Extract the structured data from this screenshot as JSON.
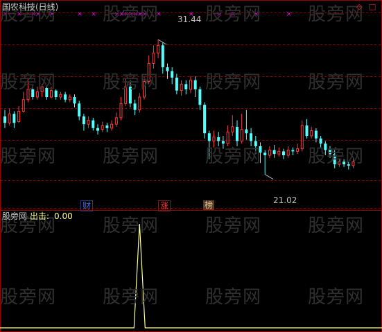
{
  "main_title": "国农科技(日线)",
  "indicator": {
    "source": "股旁网",
    "name": "出击:",
    "value": "0.00"
  },
  "annotations": {
    "high_price": "31.44",
    "low_price": "21.02"
  },
  "event_tags": [
    {
      "text": "财",
      "color": "#4d6bd6"
    },
    {
      "text": "涨",
      "color": "#e04040"
    },
    {
      "text": "榜",
      "color": "#d8c8a0"
    }
  ],
  "watermark": "股旁网",
  "colors": {
    "up": "#ff3b3b",
    "down": "#54ffff",
    "grid": "#800000",
    "signal_x": "#ff00ff",
    "indicator_line": "#ffff99",
    "price_text": "#c0c0c0",
    "title": "#c0c0c0"
  },
  "chart_data": {
    "type": "candlestick",
    "y_range": [
      19.5,
      33
    ],
    "high_marker": 31.44,
    "low_marker": 21.02,
    "candles": [
      [
        25.5,
        25.0,
        26.0,
        24.6
      ],
      [
        25.0,
        25.7,
        26.1,
        24.8
      ],
      [
        25.7,
        25.0,
        25.9,
        24.6
      ],
      [
        25.1,
        25.9,
        26.3,
        25.0
      ],
      [
        25.9,
        26.8,
        27.4,
        25.8
      ],
      [
        26.8,
        27.6,
        28.4,
        26.6
      ],
      [
        27.6,
        27.0,
        27.9,
        26.8
      ],
      [
        27.0,
        27.4,
        27.8,
        26.8
      ],
      [
        27.4,
        27.8,
        28.0,
        27.0
      ],
      [
        27.7,
        27.0,
        27.9,
        26.8
      ],
      [
        27.0,
        27.5,
        27.8,
        26.9
      ],
      [
        27.5,
        27.0,
        27.6,
        26.8
      ],
      [
        27.0,
        27.2,
        27.4,
        26.8
      ],
      [
        27.2,
        26.8,
        27.4,
        26.6
      ],
      [
        26.8,
        27.0,
        27.2,
        26.6
      ],
      [
        27.0,
        26.5,
        27.2,
        26.2
      ],
      [
        26.5,
        25.5,
        26.7,
        25.2
      ],
      [
        25.5,
        24.9,
        25.7,
        24.4
      ],
      [
        24.9,
        25.2,
        25.5,
        24.6
      ],
      [
        25.2,
        24.6,
        25.4,
        24.4
      ],
      [
        24.6,
        24.4,
        24.9,
        24.1
      ],
      [
        24.5,
        24.8,
        25.1,
        24.3
      ],
      [
        24.8,
        24.6,
        25.0,
        24.3
      ],
      [
        24.6,
        24.9,
        25.2,
        24.4
      ],
      [
        24.9,
        25.4,
        25.8,
        24.7
      ],
      [
        25.4,
        26.5,
        27.0,
        25.2
      ],
      [
        26.5,
        27.8,
        28.4,
        26.3
      ],
      [
        27.8,
        26.5,
        28.2,
        26.2
      ],
      [
        26.5,
        26.0,
        26.8,
        25.6
      ],
      [
        26.0,
        27.0,
        27.3,
        25.8
      ],
      [
        27.0,
        28.2,
        28.6,
        26.8
      ],
      [
        28.2,
        29.6,
        30.2,
        28.0
      ],
      [
        29.6,
        30.4,
        31.0,
        29.2
      ],
      [
        30.4,
        31.0,
        31.44,
        30.0
      ],
      [
        31.0,
        29.3,
        31.2,
        28.8
      ],
      [
        29.3,
        29.0,
        29.6,
        28.4
      ],
      [
        29.0,
        28.5,
        29.3,
        28.0
      ],
      [
        28.5,
        27.5,
        28.8,
        27.2
      ],
      [
        27.5,
        28.0,
        28.3,
        27.1
      ],
      [
        28.0,
        27.6,
        28.3,
        27.2
      ],
      [
        27.6,
        28.3,
        28.6,
        27.3
      ],
      [
        28.3,
        27.6,
        28.6,
        27.0
      ],
      [
        27.6,
        26.4,
        27.8,
        26.0
      ],
      [
        26.4,
        24.2,
        26.6,
        23.8
      ],
      [
        24.2,
        23.6,
        24.4,
        22.2
      ],
      [
        23.6,
        23.9,
        24.4,
        23.1
      ],
      [
        23.9,
        23.6,
        24.3,
        23.2
      ],
      [
        23.6,
        23.4,
        24.0,
        23.0
      ],
      [
        23.4,
        24.3,
        24.8,
        23.2
      ],
      [
        24.3,
        24.7,
        25.6,
        24.0
      ],
      [
        24.7,
        23.6,
        25.2,
        23.2
      ],
      [
        23.6,
        24.5,
        25.7,
        23.4
      ],
      [
        24.5,
        24.2,
        26.0,
        23.7
      ],
      [
        24.2,
        23.6,
        24.6,
        23.2
      ],
      [
        23.6,
        23.2,
        24.0,
        22.6
      ],
      [
        23.2,
        22.7,
        23.5,
        21.9
      ],
      [
        22.7,
        22.5,
        22.9,
        21.02
      ],
      [
        22.5,
        22.9,
        23.2,
        22.3
      ],
      [
        22.9,
        22.6,
        23.3,
        22.3
      ],
      [
        22.6,
        22.8,
        23.1,
        22.4
      ],
      [
        22.8,
        22.5,
        23.0,
        22.2
      ],
      [
        22.5,
        22.9,
        23.2,
        22.3
      ],
      [
        22.9,
        22.8,
        23.1,
        22.5
      ],
      [
        22.8,
        23.0,
        23.4,
        22.6
      ],
      [
        23.0,
        24.8,
        25.2,
        22.8
      ],
      [
        24.8,
        24.0,
        25.3,
        23.8
      ],
      [
        24.0,
        24.4,
        24.7,
        23.8
      ],
      [
        24.4,
        23.8,
        24.6,
        23.5
      ],
      [
        23.8,
        23.4,
        24.0,
        23.1
      ],
      [
        23.4,
        22.9,
        23.6,
        22.5
      ],
      [
        22.9,
        22.6,
        23.2,
        22.3
      ],
      [
        22.6,
        21.8,
        22.9,
        21.5
      ],
      [
        21.8,
        22.0,
        22.2,
        21.6
      ],
      [
        22.0,
        21.8,
        22.2,
        21.6
      ],
      [
        21.8,
        21.7,
        22.0,
        21.4
      ],
      [
        21.7,
        22.0,
        22.3,
        21.5
      ]
    ],
    "signal_marks_x": [
      0,
      3,
      6,
      7,
      10,
      16,
      19,
      24,
      25,
      26,
      27,
      28,
      29,
      30,
      33,
      40,
      46,
      49,
      54,
      61
    ],
    "indicator": {
      "name": "出击",
      "peak_index": 29,
      "peak_value": 1,
      "values_note": "zero except single spike"
    }
  }
}
